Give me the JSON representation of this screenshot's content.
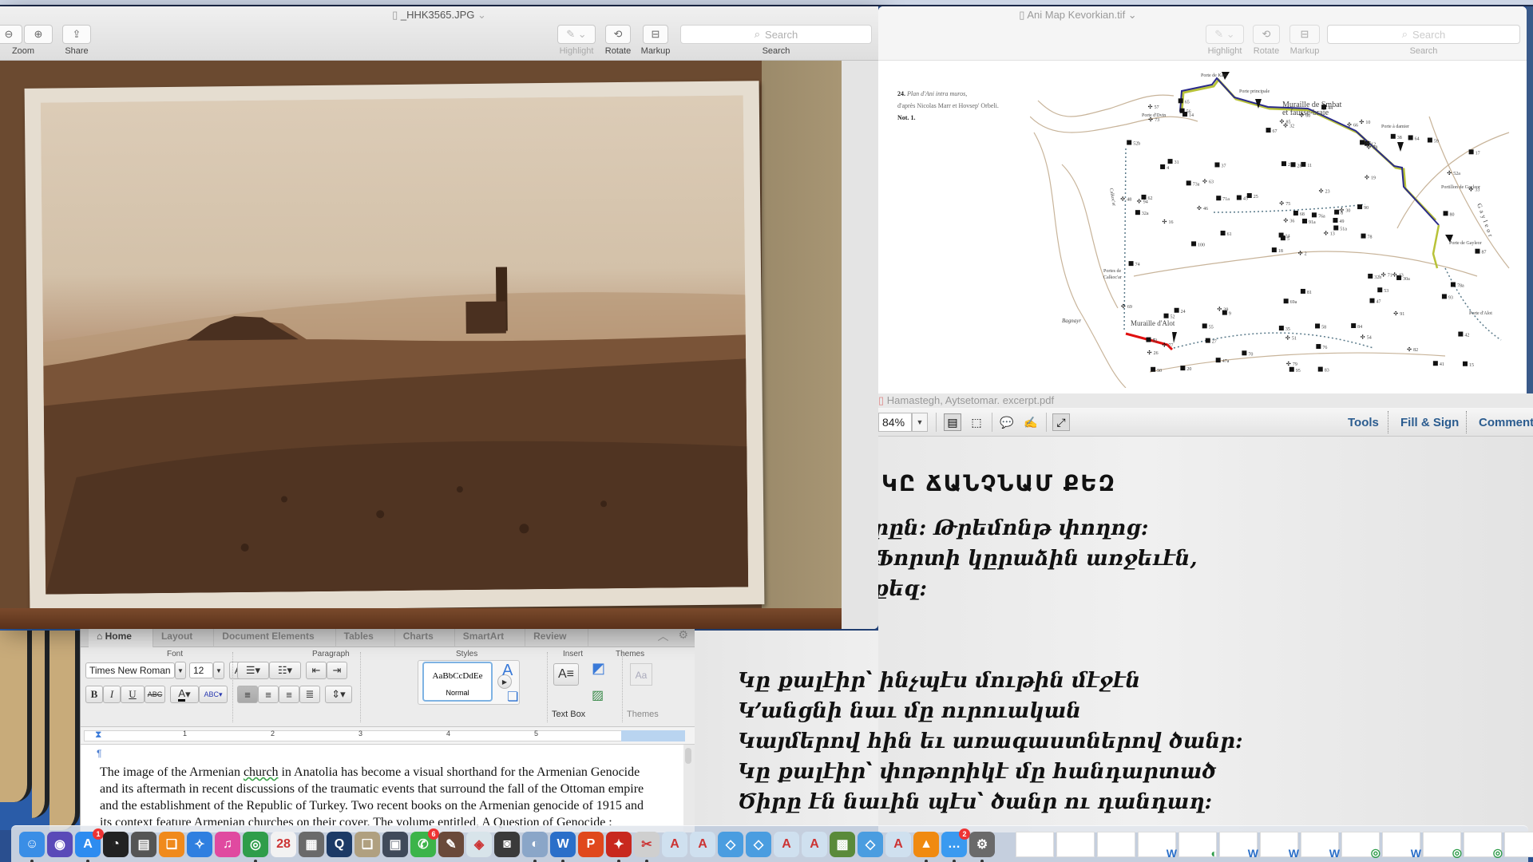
{
  "preview_photo": {
    "title": "_HHK3565.JPG",
    "toolbar": {
      "zoom_label": "Zoom",
      "share_label": "Share",
      "highlight_label": "Highlight",
      "rotate_label": "Rotate",
      "markup_label": "Markup",
      "search_placeholder": "Search",
      "search_label": "Search"
    }
  },
  "preview_map": {
    "title": "Ani Map Kevorkian.tif",
    "toolbar": {
      "highlight_label": "Highlight",
      "rotate_label": "Rotate",
      "markup_label": "Markup",
      "search_placeholder": "Search",
      "search_label": "Search"
    },
    "caption": {
      "number": "24.",
      "title": "Plan d'Ani intra muros,",
      "line2": "d'après Nicolas Marr et Hovsep' Orbeli.",
      "note": "Not. 1."
    },
    "labels": {
      "porte_kars": "Porte de Kars",
      "porte_principale": "Porte principale",
      "muraille_smbat_1": "Muraille de Smbat",
      "muraille_smbat_2": "et fausse-braie",
      "porte_damier": "Porte à damier",
      "porte_dvin": "Porte d'Dvin",
      "portillon_gayleor": "Portillon de Gayleor",
      "porte_gayleor": "Porte de Gayleor",
      "gayleor_river": "Gayleor",
      "calkocar_river": "Calkoc'ar",
      "portes_calkocar_1": "Portes de",
      "portes_calkocar_2": "Calkoc'ar",
      "muraille_alot": "Muraille d'Alot",
      "bagnayr": "Bagnayr",
      "porte_alot": "Porte d'Alot"
    },
    "markers": [
      "2",
      "4",
      "5",
      "6",
      "8",
      "9",
      "10",
      "11",
      "12",
      "13",
      "14",
      "15",
      "16",
      "17",
      "18",
      "19",
      "20",
      "21",
      "23",
      "24",
      "25",
      "26",
      "27",
      "28",
      "30",
      "30a",
      "31",
      "32",
      "32a",
      "32b",
      "33",
      "34",
      "35",
      "36",
      "37",
      "38",
      "39",
      "41",
      "42",
      "43",
      "44",
      "45",
      "46",
      "47",
      "47a",
      "48",
      "49",
      "50",
      "51",
      "51a",
      "52",
      "52a",
      "52b",
      "53",
      "54",
      "55",
      "56",
      "57",
      "58",
      "59",
      "60",
      "61",
      "62",
      "63",
      "64",
      "65",
      "66",
      "67",
      "68",
      "69",
      "69a",
      "70",
      "71",
      "71a",
      "72",
      "73",
      "73a",
      "74",
      "75",
      "76",
      "76a",
      "77",
      "78",
      "78a",
      "79",
      "80",
      "81",
      "82",
      "83",
      "84",
      "85",
      "87",
      "90",
      "91",
      "91a",
      "93",
      "94",
      "95",
      "97",
      "98",
      "100"
    ]
  },
  "acrobat": {
    "title": "Hamastegh, Aytsetomar. excerpt.pdf",
    "zoom_value": "84%",
    "tools_label": "Tools",
    "fill_sign_label": "Fill & Sign",
    "comment_label": "Comment",
    "page": {
      "heading": "ԿԸ ՃԱՆՉՆԱՄ ՔԵԶ",
      "lines_top": [
        "րըն: Թրեմոնթ փողոց:",
        "Ֆորտի կըրաձին առջեւէն,",
        " քեզ:"
      ],
      "lines_bottom": [
        "Կը քալէիր՝ ինչպէս մութին մէջէն",
        "Կ՚անցնի նաւ մը ուրուական",
        "Կայմերով հին եւ առագաստներով ծանր:",
        "Կը քալէիր՝ փոթորիկէ մը հանդարտած",
        "Ծիրը էն նաւին պէս՝ ծանր ու դանդաղ:"
      ]
    }
  },
  "word": {
    "tabs": [
      "Home",
      "Layout",
      "Document Elements",
      "Tables",
      "Charts",
      "SmartArt",
      "Review"
    ],
    "groups": {
      "font": "Font",
      "paragraph": "Paragraph",
      "styles": "Styles",
      "insert": "Insert",
      "themes": "Themes"
    },
    "font_name": "Times New Roman",
    "font_size": "12",
    "style_preview": "AaBbCcDdEe",
    "style_name": "Normal",
    "text_box_label": "Text Box",
    "themes_label": "Themes",
    "bold": "B",
    "italic": "I",
    "underline": "U",
    "strike": "ABC",
    "ruler_numbers": [
      "1",
      "2",
      "3",
      "4",
      "5"
    ],
    "pilcrow": "¶",
    "paragraph": {
      "before": "The image of the Armenian ",
      "flagged_word": "church",
      "after": " in Anatolia has become a visual shorthand for the Armenian Genocide and its aftermath in recent discussions of the traumatic events that surround the fall of the Ottoman empire and the establishment of the Republic of Turkey. Two recent books on the Armenian genocide of 1915 and its context feature Armenian churches on their cover. The volume entitled, A Question of Genocide : Armenians and"
    }
  },
  "dock": {
    "apps": [
      {
        "name": "finder",
        "color": "#3a8ee6",
        "glyph": "☺",
        "running": true
      },
      {
        "name": "siri",
        "color": "#5a4ab8",
        "glyph": "◉",
        "running": false
      },
      {
        "name": "app-store",
        "color": "#2d8cf0",
        "glyph": "A",
        "running": true,
        "badge": "1"
      },
      {
        "name": "dashboard",
        "color": "#222222",
        "glyph": "◔",
        "running": false
      },
      {
        "name": "printer",
        "color": "#555555",
        "glyph": "▤",
        "running": false
      },
      {
        "name": "ibooks",
        "color": "#f08a1c",
        "glyph": "❑",
        "running": false
      },
      {
        "name": "safari",
        "color": "#2f7fe0",
        "glyph": "✧",
        "running": false
      },
      {
        "name": "itunes",
        "color": "#e04aa0",
        "glyph": "♫",
        "running": false
      },
      {
        "name": "chrome",
        "color": "#2f9d4a",
        "glyph": "◎",
        "running": true
      },
      {
        "name": "calendar",
        "color": "#f2f2f2",
        "glyph": "28",
        "running": false
      },
      {
        "name": "calculator",
        "color": "#6a6a6a",
        "glyph": "▦",
        "running": false
      },
      {
        "name": "quicktime",
        "color": "#1c3a66",
        "glyph": "Q",
        "running": false
      },
      {
        "name": "image-capture",
        "color": "#b0a080",
        "glyph": "❏",
        "running": false
      },
      {
        "name": "preview-device",
        "color": "#404a5a",
        "glyph": "▣",
        "running": false
      },
      {
        "name": "facetime",
        "color": "#3cb44a",
        "glyph": "✆",
        "running": false,
        "badge": "6"
      },
      {
        "name": "app-misc",
        "color": "#6a4a3a",
        "glyph": "✎",
        "running": false
      },
      {
        "name": "maps",
        "color": "#d8e4ea",
        "glyph": "◈",
        "running": false
      },
      {
        "name": "screenshot",
        "color": "#3a3a3a",
        "glyph": "◙",
        "running": false
      },
      {
        "name": "preview",
        "color": "#8aa6c8",
        "glyph": "◐",
        "running": true
      },
      {
        "name": "word",
        "color": "#2a6fc9",
        "glyph": "W",
        "running": true
      },
      {
        "name": "powerpoint",
        "color": "#e0481c",
        "glyph": "P",
        "running": false
      },
      {
        "name": "acrobat",
        "color": "#c8281e",
        "glyph": "✦",
        "running": true
      },
      {
        "name": "script-editor",
        "color": "#cfcfcf",
        "glyph": "✂",
        "running": true
      },
      {
        "name": "doc-a1",
        "color": "#cfe0ef",
        "glyph": "A",
        "running": false
      },
      {
        "name": "doc-a2",
        "color": "#cfe0ef",
        "glyph": "A",
        "running": false
      },
      {
        "name": "doc-blue1",
        "color": "#4a9de0",
        "glyph": "◇",
        "running": false
      },
      {
        "name": "doc-blue2",
        "color": "#4a9de0",
        "glyph": "◇",
        "running": false
      },
      {
        "name": "doc-a3",
        "color": "#cfe0ef",
        "glyph": "A",
        "running": false
      },
      {
        "name": "doc-a4",
        "color": "#cfe0ef",
        "glyph": "A",
        "running": false
      },
      {
        "name": "minecraft",
        "color": "#5a8a3a",
        "glyph": "▩",
        "running": false
      },
      {
        "name": "doc-blue3",
        "color": "#4a9de0",
        "glyph": "◇",
        "running": false
      },
      {
        "name": "doc-a5",
        "color": "#cfe0ef",
        "glyph": "A",
        "running": false
      },
      {
        "name": "vlc",
        "color": "#f08a10",
        "glyph": "▲",
        "running": true
      },
      {
        "name": "messages",
        "color": "#3a9af0",
        "glyph": "…",
        "running": true,
        "badge": "2"
      },
      {
        "name": "system-preferences",
        "color": "#6a6a6a",
        "glyph": "⚙",
        "running": true
      }
    ],
    "minimized": [
      "doc",
      "chrome-window",
      "mail",
      "word-doc-1",
      "acrobat-window",
      "word-doc-2",
      "word-doc-3",
      "word-doc-4",
      "chrome-1",
      "word-doc-5",
      "chrome-2",
      "chrome-3",
      "word-doc-6",
      "chrome-4",
      "chrome-5",
      "chrome-6",
      "chrome-7"
    ],
    "minimized_badges": [
      "",
      "",
      "",
      "W",
      "◐",
      "W",
      "W",
      "W",
      "◎",
      "W",
      "◎",
      "◎",
      "W",
      "◎",
      "◎",
      "◎",
      "◎"
    ]
  }
}
